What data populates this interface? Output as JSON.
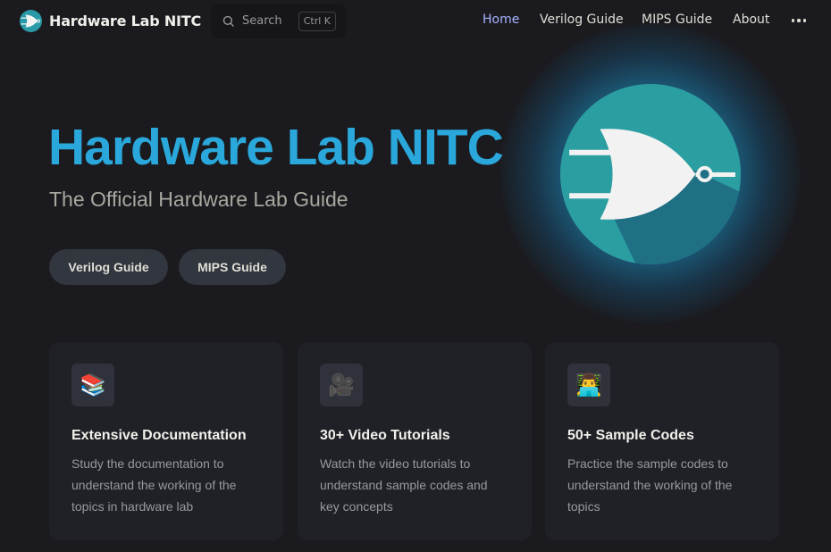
{
  "nav": {
    "brand": "Hardware Lab NITC",
    "search": {
      "label": "Search",
      "shortcut": "Ctrl K"
    },
    "links": [
      "Home",
      "Verilog Guide",
      "MIPS Guide",
      "About"
    ],
    "active": "Home",
    "more_icon": "ellipsis-icon"
  },
  "hero": {
    "title": "Hardware Lab NITC",
    "subtitle": "The Official Hardware Lab Guide",
    "actions": [
      "Verilog Guide",
      "MIPS Guide"
    ],
    "logo_icon": "or-gate-logo-icon"
  },
  "features": [
    {
      "icon": "📚",
      "title": "Extensive Documentation",
      "desc": "Study the documentation to understand the working of the topics in hardware lab"
    },
    {
      "icon": "🎥",
      "title": "30+ Video Tutorials",
      "desc": "Watch the video tutorials to understand sample codes and key concepts"
    },
    {
      "icon": "👨‍💻",
      "title": "50+ Sample Codes",
      "desc": "Practice the sample codes to understand the working of the topics"
    }
  ],
  "colors": {
    "background": "#1b1b1f",
    "brand": "#2aa8dc",
    "active_link": "#a8b1ff",
    "card": "#202127",
    "button": "#32363f"
  }
}
